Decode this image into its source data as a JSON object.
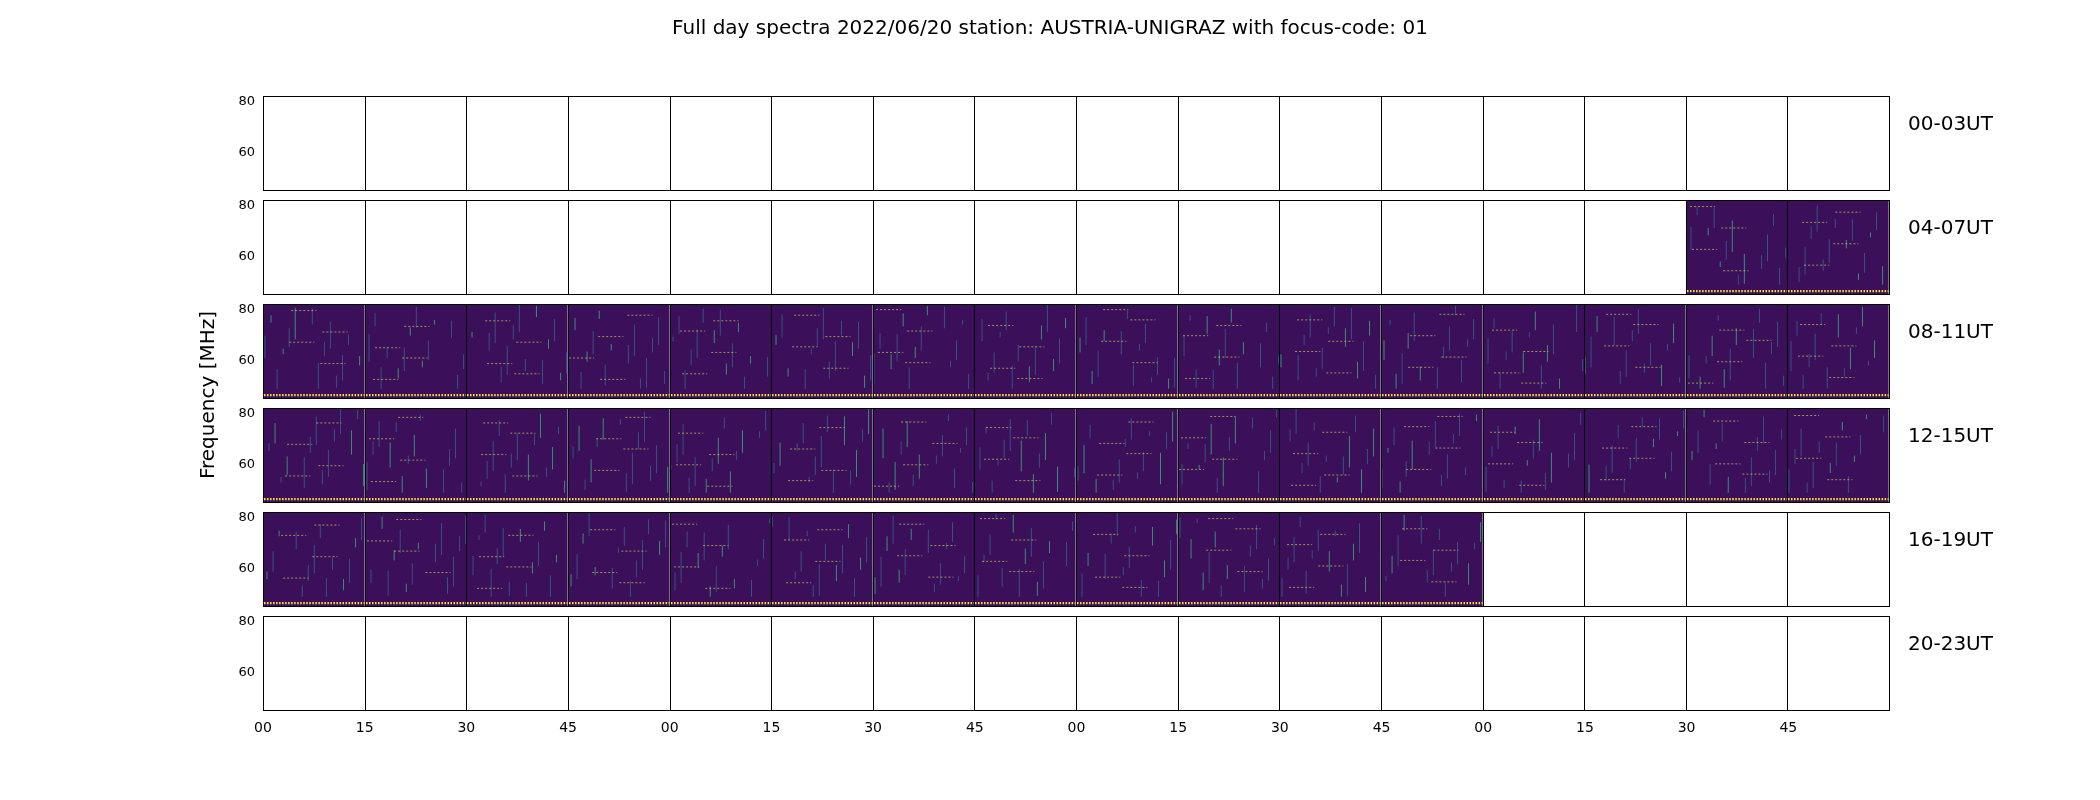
{
  "title": "Full day spectra 2022/06/20 station: AUSTRIA-UNIGRAZ with focus-code: 01",
  "ylabel": "Frequency [MHz]",
  "xticks": [
    "00",
    "15",
    "30",
    "45",
    "00",
    "15",
    "30",
    "45",
    "00",
    "15",
    "30",
    "45",
    "00",
    "15",
    "30",
    "45"
  ],
  "rows": [
    {
      "label": "00-03UT",
      "yticks": [
        "80",
        "60"
      ],
      "panels": [
        {
          "filled": false
        },
        {
          "filled": false
        },
        {
          "filled": false
        },
        {
          "filled": false
        },
        {
          "filled": false
        },
        {
          "filled": false
        },
        {
          "filled": false
        },
        {
          "filled": false
        },
        {
          "filled": false
        },
        {
          "filled": false
        },
        {
          "filled": false
        },
        {
          "filled": false
        },
        {
          "filled": false
        },
        {
          "filled": false
        },
        {
          "filled": false
        },
        {
          "filled": false
        }
      ]
    },
    {
      "label": "04-07UT",
      "yticks": [
        "80",
        "60"
      ],
      "panels": [
        {
          "filled": false
        },
        {
          "filled": false
        },
        {
          "filled": false
        },
        {
          "filled": false
        },
        {
          "filled": false
        },
        {
          "filled": false
        },
        {
          "filled": false
        },
        {
          "filled": false
        },
        {
          "filled": false
        },
        {
          "filled": false
        },
        {
          "filled": false
        },
        {
          "filled": false
        },
        {
          "filled": false
        },
        {
          "filled": false
        },
        {
          "filled": true
        },
        {
          "filled": true
        }
      ]
    },
    {
      "label": "08-11UT",
      "yticks": [
        "80",
        "60"
      ],
      "panels": [
        {
          "filled": true
        },
        {
          "filled": true
        },
        {
          "filled": true
        },
        {
          "filled": true
        },
        {
          "filled": true
        },
        {
          "filled": true
        },
        {
          "filled": true
        },
        {
          "filled": true
        },
        {
          "filled": true
        },
        {
          "filled": true
        },
        {
          "filled": true
        },
        {
          "filled": true
        },
        {
          "filled": true
        },
        {
          "filled": true
        },
        {
          "filled": true
        },
        {
          "filled": true
        }
      ]
    },
    {
      "label": "12-15UT",
      "yticks": [
        "80",
        "60"
      ],
      "panels": [
        {
          "filled": true
        },
        {
          "filled": true
        },
        {
          "filled": true
        },
        {
          "filled": true
        },
        {
          "filled": true
        },
        {
          "filled": true
        },
        {
          "filled": true
        },
        {
          "filled": true
        },
        {
          "filled": true
        },
        {
          "filled": true
        },
        {
          "filled": true
        },
        {
          "filled": true
        },
        {
          "filled": true
        },
        {
          "filled": true
        },
        {
          "filled": true
        },
        {
          "filled": true
        }
      ]
    },
    {
      "label": "16-19UT",
      "yticks": [
        "80",
        "60"
      ],
      "panels": [
        {
          "filled": true
        },
        {
          "filled": true
        },
        {
          "filled": true
        },
        {
          "filled": true
        },
        {
          "filled": true
        },
        {
          "filled": true
        },
        {
          "filled": true
        },
        {
          "filled": true
        },
        {
          "filled": true
        },
        {
          "filled": true
        },
        {
          "filled": true
        },
        {
          "filled": true
        },
        {
          "filled": false
        },
        {
          "filled": false
        },
        {
          "filled": false
        },
        {
          "filled": false
        }
      ]
    },
    {
      "label": "20-23UT",
      "yticks": [
        "80",
        "60"
      ],
      "panels": [
        {
          "filled": false
        },
        {
          "filled": false
        },
        {
          "filled": false
        },
        {
          "filled": false
        },
        {
          "filled": false
        },
        {
          "filled": false
        },
        {
          "filled": false
        },
        {
          "filled": false
        },
        {
          "filled": false
        },
        {
          "filled": false
        },
        {
          "filled": false
        },
        {
          "filled": false
        },
        {
          "filled": false
        },
        {
          "filled": false
        },
        {
          "filled": false
        },
        {
          "filled": false
        }
      ]
    }
  ]
}
